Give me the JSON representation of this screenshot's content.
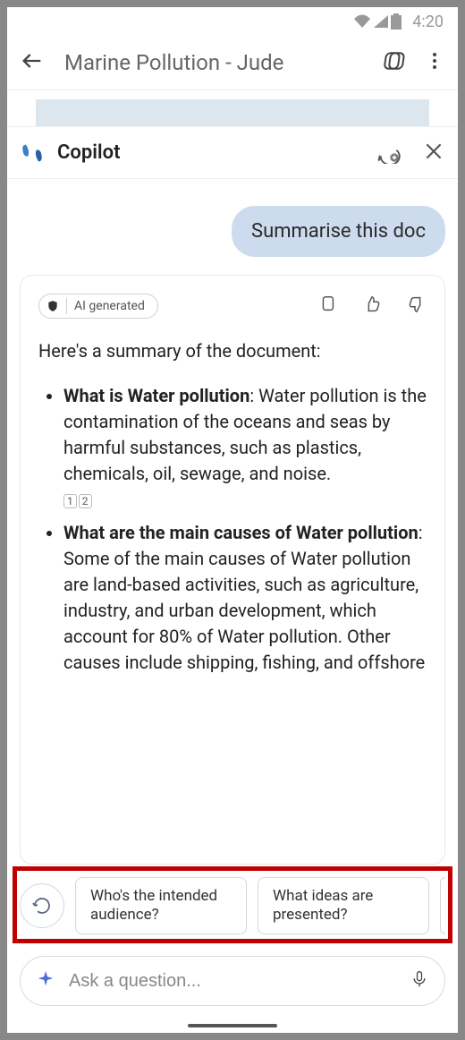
{
  "status": {
    "time": "4:20"
  },
  "header": {
    "title": "Marine Pollution - Jude"
  },
  "copilot": {
    "title": "Copilot"
  },
  "user_prompt": "Summarise this doc",
  "ai_badge": "AI generated",
  "summary_intro": "Here's a summary of the document:",
  "bullets": [
    {
      "bold": "What is Water pollution",
      "text": ": Water pollution is the contamination of the oceans and seas by harmful substances, such as plastics, chemicals, oil, sewage, and noise.",
      "refs": [
        "1",
        "2"
      ]
    },
    {
      "bold": "What are the main causes of Water pollution",
      "text": ": Some of the main causes of Water pollution are land-based activities, such as agriculture, industry, and urban development, which account for 80% of Water pollution. Other causes include shipping, fishing, and offshore",
      "refs": []
    }
  ],
  "suggestions": [
    "Who's the intended audience?",
    "What ideas are presented?"
  ],
  "input": {
    "placeholder": "Ask a question..."
  }
}
